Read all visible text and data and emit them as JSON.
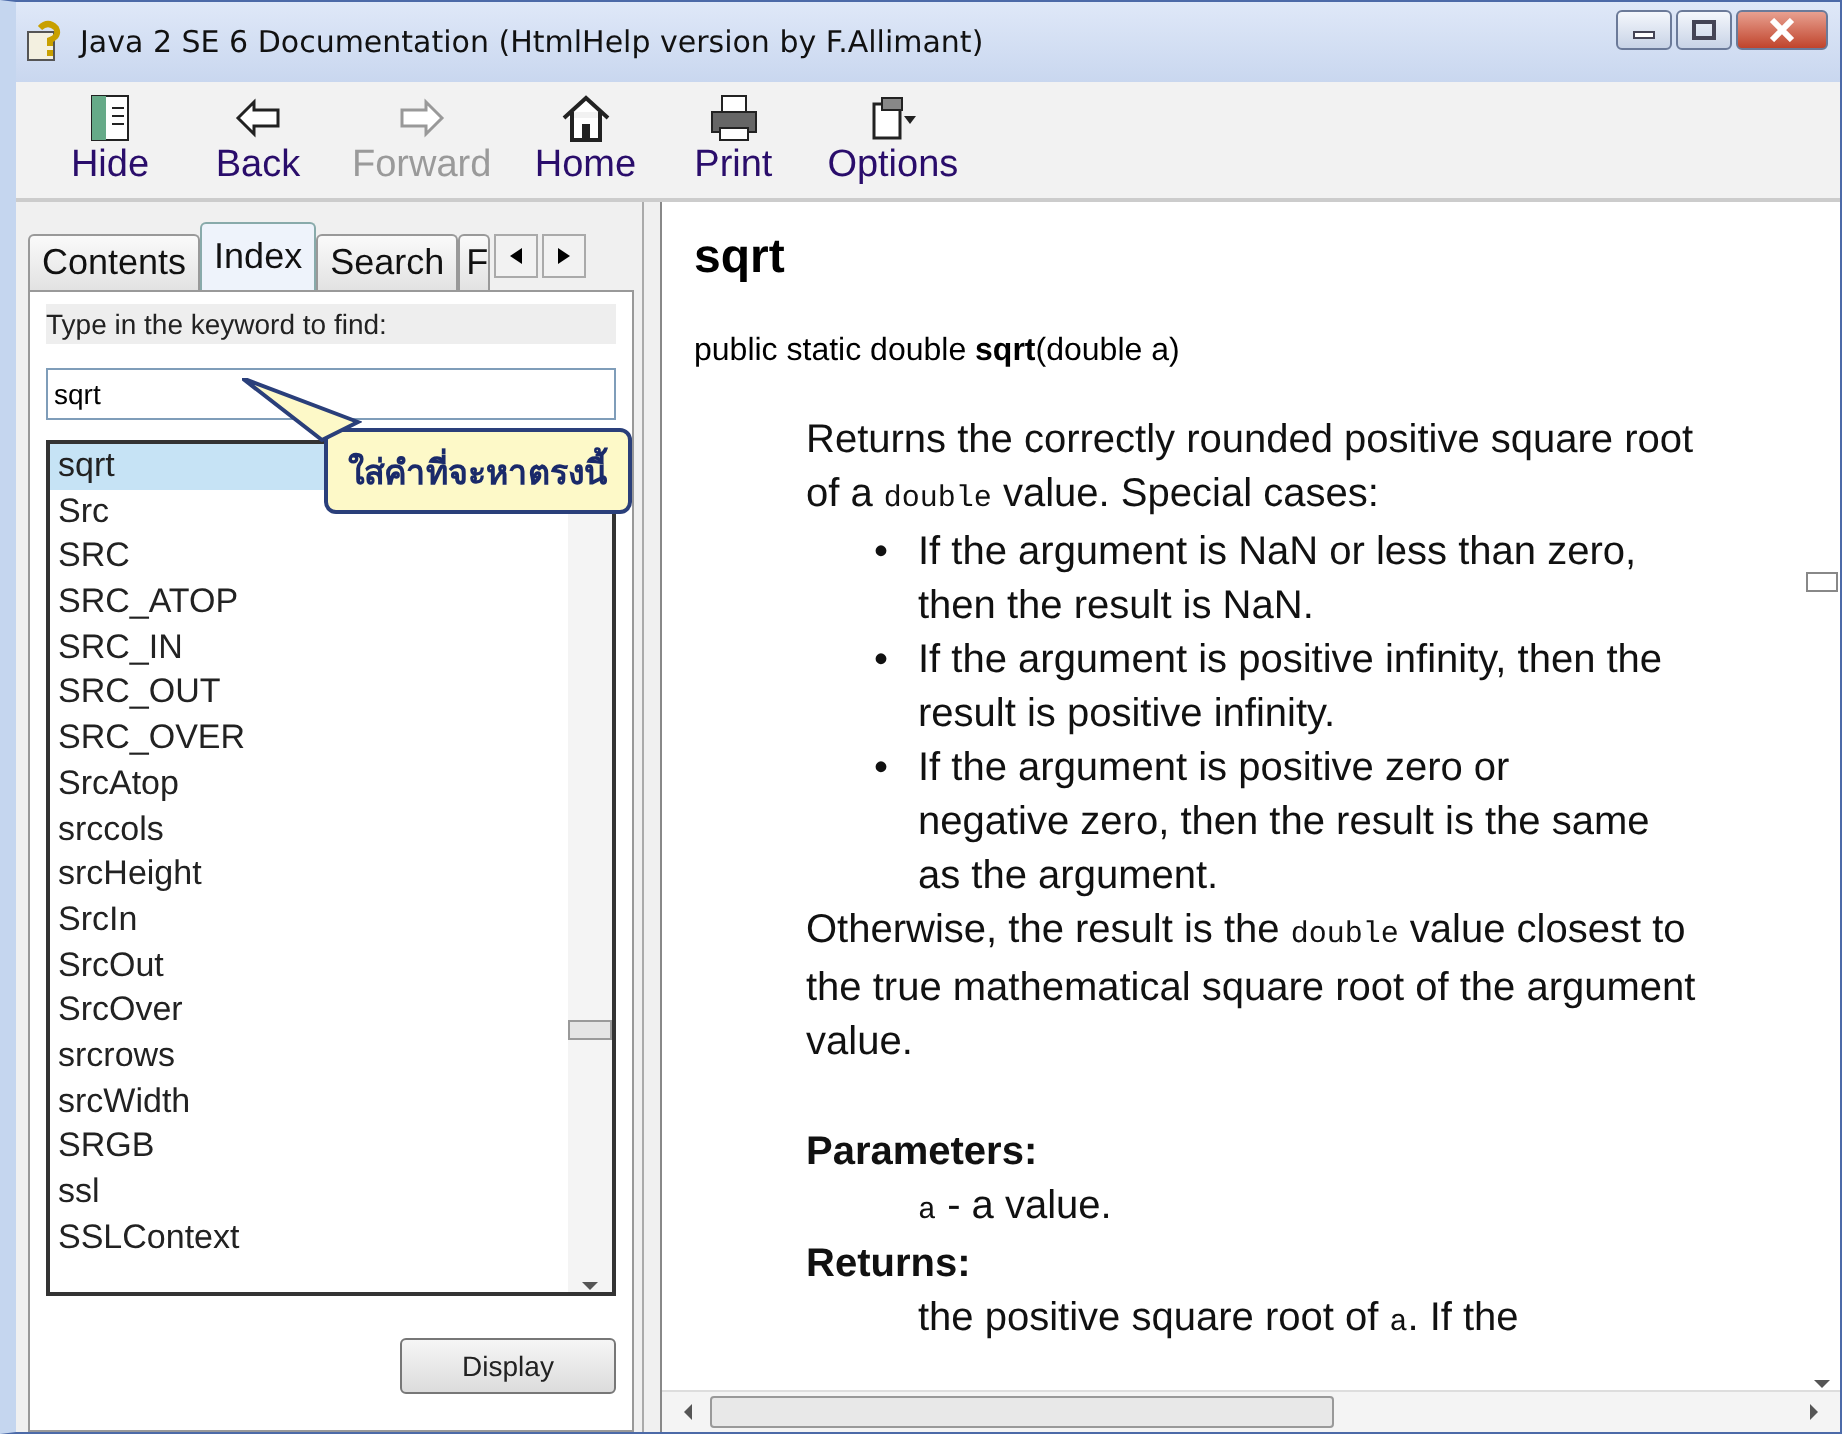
{
  "window": {
    "title": "Java 2 SE 6 Documentation (HtmlHelp version by F.Allimant)"
  },
  "toolbar": [
    {
      "kind": "hide",
      "label": "Hide",
      "disabled": false
    },
    {
      "kind": "back",
      "label": "Back",
      "disabled": false
    },
    {
      "kind": "forward",
      "label": "Forward",
      "disabled": true
    },
    {
      "kind": "home",
      "label": "Home",
      "disabled": false
    },
    {
      "kind": "print",
      "label": "Print",
      "disabled": false
    },
    {
      "kind": "options",
      "label": "Options",
      "disabled": false
    }
  ],
  "sidebar": {
    "tabs": [
      {
        "label": "Contents",
        "selected": false
      },
      {
        "label": "Index",
        "selected": true
      },
      {
        "label": "Search",
        "selected": false
      },
      {
        "label": "F",
        "selected": false
      }
    ],
    "prompt": "Type in the keyword to find:",
    "keyword": "sqrt",
    "callout": "ใส่คำที่จะหาตรงนี้",
    "items": [
      {
        "label": "sqrt",
        "selected": true
      },
      {
        "label": "Src",
        "selected": false
      },
      {
        "label": "SRC",
        "selected": false
      },
      {
        "label": "SRC_ATOP",
        "selected": false
      },
      {
        "label": "SRC_IN",
        "selected": false
      },
      {
        "label": "SRC_OUT",
        "selected": false
      },
      {
        "label": "SRC_OVER",
        "selected": false
      },
      {
        "label": "SrcAtop",
        "selected": false
      },
      {
        "label": "srccols",
        "selected": false
      },
      {
        "label": "srcHeight",
        "selected": false
      },
      {
        "label": "SrcIn",
        "selected": false
      },
      {
        "label": "SrcOut",
        "selected": false
      },
      {
        "label": "SrcOver",
        "selected": false
      },
      {
        "label": "srcrows",
        "selected": false
      },
      {
        "label": "srcWidth",
        "selected": false
      },
      {
        "label": "SRGB",
        "selected": false
      },
      {
        "label": "ssl",
        "selected": false
      },
      {
        "label": "SSLContext",
        "selected": false
      }
    ],
    "display_button": "Display"
  },
  "content": {
    "title": "sqrt",
    "signature": "public static double **sqrt**(double a)",
    "description": [
      {
        "kind": "text",
        "text": "Returns the correctly rounded positive square root of a "
      },
      {
        "kind": "code",
        "text": "double"
      },
      {
        "kind": "text",
        "text": " value. Special cases:"
      }
    ],
    "bullets": [
      {
        "marker": "•",
        "text": "If the argument is NaN or less than zero, then the result is NaN."
      },
      {
        "marker": "•",
        "text": "If the argument is positive infinity, then the result is positive infinity."
      },
      {
        "marker": "•",
        "text": "If the argument is positive zero or negative zero, then the result is the same as the argument."
      }
    ],
    "otherwise": [
      {
        "kind": "text",
        "text": "Otherwise, the result is the "
      },
      {
        "kind": "code",
        "text": "double"
      },
      {
        "kind": "text",
        "text": " value closest to the true mathematical square root of the argument value."
      }
    ],
    "parameters_heading": "Parameters:",
    "parameters": [
      {
        "kind": "code",
        "text": "a"
      },
      {
        "kind": "text",
        "text": " - a value."
      }
    ],
    "returns_heading": "Returns:",
    "returns": [
      {
        "kind": "text",
        "text": "the positive square root of "
      },
      {
        "kind": "code",
        "text": "a"
      },
      {
        "kind": "text",
        "text": ". If the"
      }
    ]
  }
}
